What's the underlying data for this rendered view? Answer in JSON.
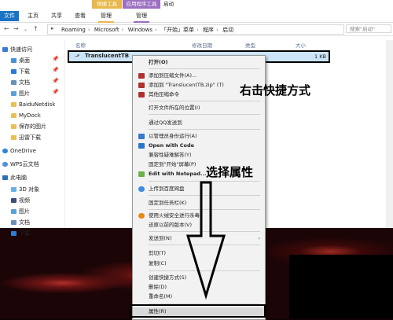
{
  "window": {
    "ctx_tab_1": "快捷工具",
    "ctx_tab_2": "应用程序工具",
    "title": "启动",
    "tabs": [
      "文件",
      "主页",
      "共享",
      "查看",
      "管理",
      "管理"
    ]
  },
  "address": {
    "path": [
      "Roaming",
      "Microsoft",
      "Windows",
      "「开始」菜单",
      "程序",
      "启动"
    ],
    "search_placeholder": "搜索\"启动\""
  },
  "sidebar": {
    "items": [
      {
        "label": "快速访问",
        "icon": "star-icon",
        "pinned": false
      },
      {
        "label": "桌面",
        "icon": "desktop-folder-icon",
        "pinned": true
      },
      {
        "label": "下载",
        "icon": "download-folder-icon",
        "pinned": true
      },
      {
        "label": "文档",
        "icon": "document-folder-icon",
        "pinned": true
      },
      {
        "label": "图片",
        "icon": "picture-folder-icon",
        "pinned": true
      },
      {
        "label": "BaiduNetdisk",
        "icon": "folder-icon",
        "pinned": false
      },
      {
        "label": "MyDock",
        "icon": "folder-icon",
        "pinned": false
      },
      {
        "label": "保存的图片",
        "icon": "folder-icon",
        "pinned": false
      },
      {
        "label": "迅雷下载",
        "icon": "folder-icon",
        "pinned": false
      },
      {
        "label": "OneDrive",
        "icon": "cloud-icon",
        "pinned": false
      },
      {
        "label": "WPS云文档",
        "icon": "cloud-icon",
        "pinned": false
      },
      {
        "label": "此电脑",
        "icon": "computer-icon",
        "pinned": false
      },
      {
        "label": "3D 对象",
        "icon": "3d-folder-icon",
        "pinned": false
      },
      {
        "label": "视频",
        "icon": "video-folder-icon",
        "pinned": false
      },
      {
        "label": "图片",
        "icon": "picture-folder-icon",
        "pinned": false
      },
      {
        "label": "文档",
        "icon": "document-folder-icon",
        "pinned": false
      },
      {
        "label": "下载",
        "icon": "download-folder-icon",
        "pinned": false
      }
    ]
  },
  "content": {
    "columns": [
      "名称",
      "修改日期",
      "类型",
      "大小"
    ],
    "file": {
      "name": "TranslucentTB",
      "size": "1 KB"
    }
  },
  "menu": {
    "items": [
      {
        "label": "打开(O)",
        "icon": ""
      },
      {
        "label": "添加到压缩文件(A)...",
        "icon": "archive-icon"
      },
      {
        "label": "添加到 \"TranslucentTB.zip\" (T)",
        "icon": "archive-icon"
      },
      {
        "label": "其他压缩命令",
        "icon": "archive-icon",
        "submenu": true
      },
      {
        "label": "打开文件所在的位置(I)",
        "icon": ""
      },
      {
        "label": "通过QQ发送到",
        "icon": ""
      },
      {
        "label": "以管理员身份运行(A)",
        "icon": "shield-icon"
      },
      {
        "label": "Open with Code",
        "icon": "vscode-icon"
      },
      {
        "label": "兼容性疑难解答(Y)",
        "icon": ""
      },
      {
        "label": "固定到\"开始\"屏幕(P)",
        "icon": ""
      },
      {
        "label": "Edit with Notepad...",
        "icon": "notepad-icon"
      },
      {
        "label": "上传到百度网盘",
        "icon": "baidu-icon"
      },
      {
        "label": "固定到任务栏(K)",
        "icon": ""
      },
      {
        "label": "使用火绒安全进行杀毒",
        "icon": "huorong-icon"
      },
      {
        "label": "还原以前的版本(V)",
        "icon": ""
      },
      {
        "label": "发送到(N)",
        "icon": "",
        "submenu": true
      },
      {
        "label": "剪切(T)",
        "icon": ""
      },
      {
        "label": "复制(C)",
        "icon": ""
      },
      {
        "label": "创建快捷方式(S)",
        "icon": ""
      },
      {
        "label": "删除(D)",
        "icon": ""
      },
      {
        "label": "重命名(M)",
        "icon": ""
      },
      {
        "label": "属性(R)",
        "icon": ""
      }
    ]
  },
  "annotations": {
    "right_click_text": "右击快捷方式",
    "select_props_text": "选择属性"
  },
  "colors": {
    "file_tab": "#1a73c4",
    "ctx_tab_1": "#e8b84a",
    "ctx_tab_2": "#9c6fc0",
    "selection": "#cce4f7"
  }
}
